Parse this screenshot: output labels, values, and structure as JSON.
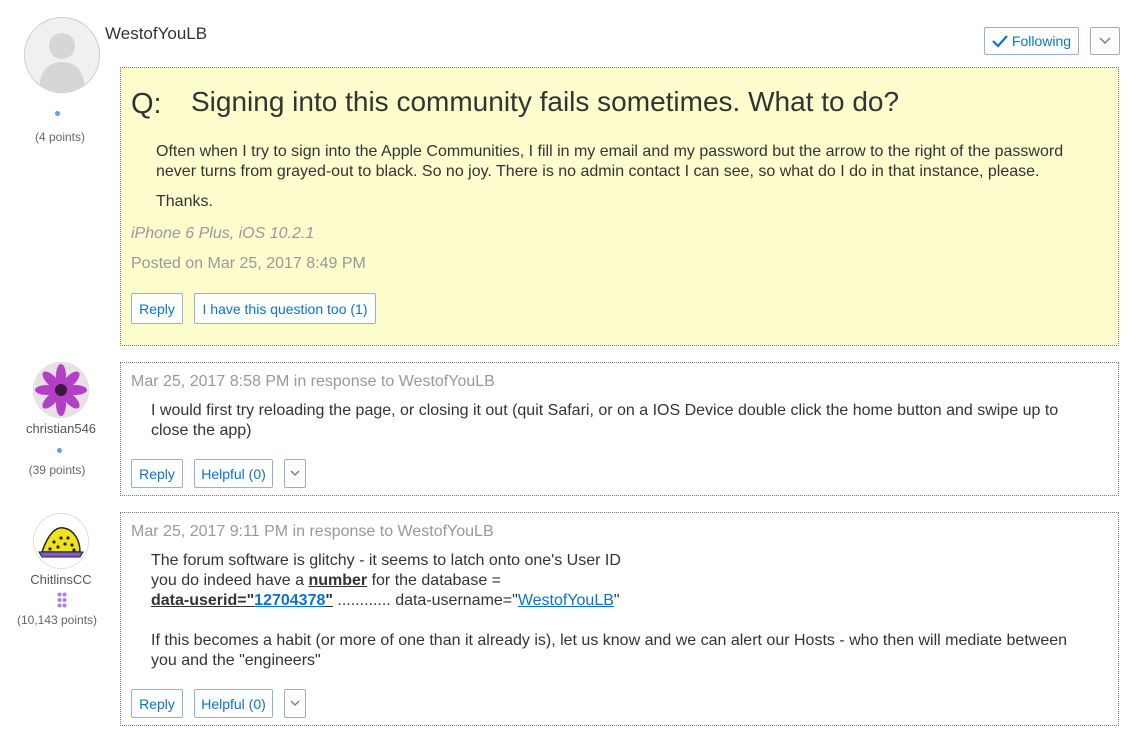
{
  "question": {
    "author": "WestofYouLB",
    "author_points": "(4 points)",
    "follow_label": "Following",
    "q_label": "Q:",
    "title": "Signing into this community fails sometimes. What to do?",
    "body": [
      "Often when I try to sign into the Apple Communities, I fill in my email and my password but the arrow to the right of the password never turns from grayed-out to black. So no joy. There is no admin contact I can see, so what do I do in that instance, please.",
      "Thanks."
    ],
    "device": "iPhone 6 Plus, iOS 10.2.1",
    "posted": "Posted on Mar 25, 2017 8:49 PM",
    "reply_label": "Reply",
    "me_too_label": "I have this question too (1)"
  },
  "replies": [
    {
      "author": "christian546",
      "points": "(39 points)",
      "date": "Mar 25, 2017 8:58 PM",
      "in_response": "in response to",
      "to": "WestofYouLB",
      "body": "I would first try reloading the page, or closing it out (quit  Safari, or on a IOS Device double click the home button and swipe up to close the app)",
      "reply_label": "Reply",
      "helpful_label": "Helpful (0)"
    },
    {
      "author": "ChitlinsCC",
      "points": "(10,143 points)",
      "date": "Mar 25, 2017 9:11 PM",
      "in_response": "in response to",
      "to": "WestofYouLB",
      "line1": "The forum software is glitchy - it seems to latch onto one's User ID",
      "line2_pre": "you do indeed have a ",
      "line2_bold": "number",
      "line2_post": " for the database =",
      "line3_key": "data-userid=\"",
      "line3_id": "12704378",
      "line3_close": "\"",
      "line3_mid": " ............ data-username=\"",
      "line3_user": "WestofYouLB",
      "line3_end": "\"",
      "line4": "If this becomes a habit (or more of one than it already is), let us know and we can alert our Hosts - who then will mediate between you and the \"engineers\"",
      "reply_label": "Reply",
      "helpful_label": "Helpful (0)"
    }
  ],
  "colors": {
    "accent": "#0d72c8",
    "question_bg": "#fdfdcd",
    "meta_gray": "#999999"
  }
}
